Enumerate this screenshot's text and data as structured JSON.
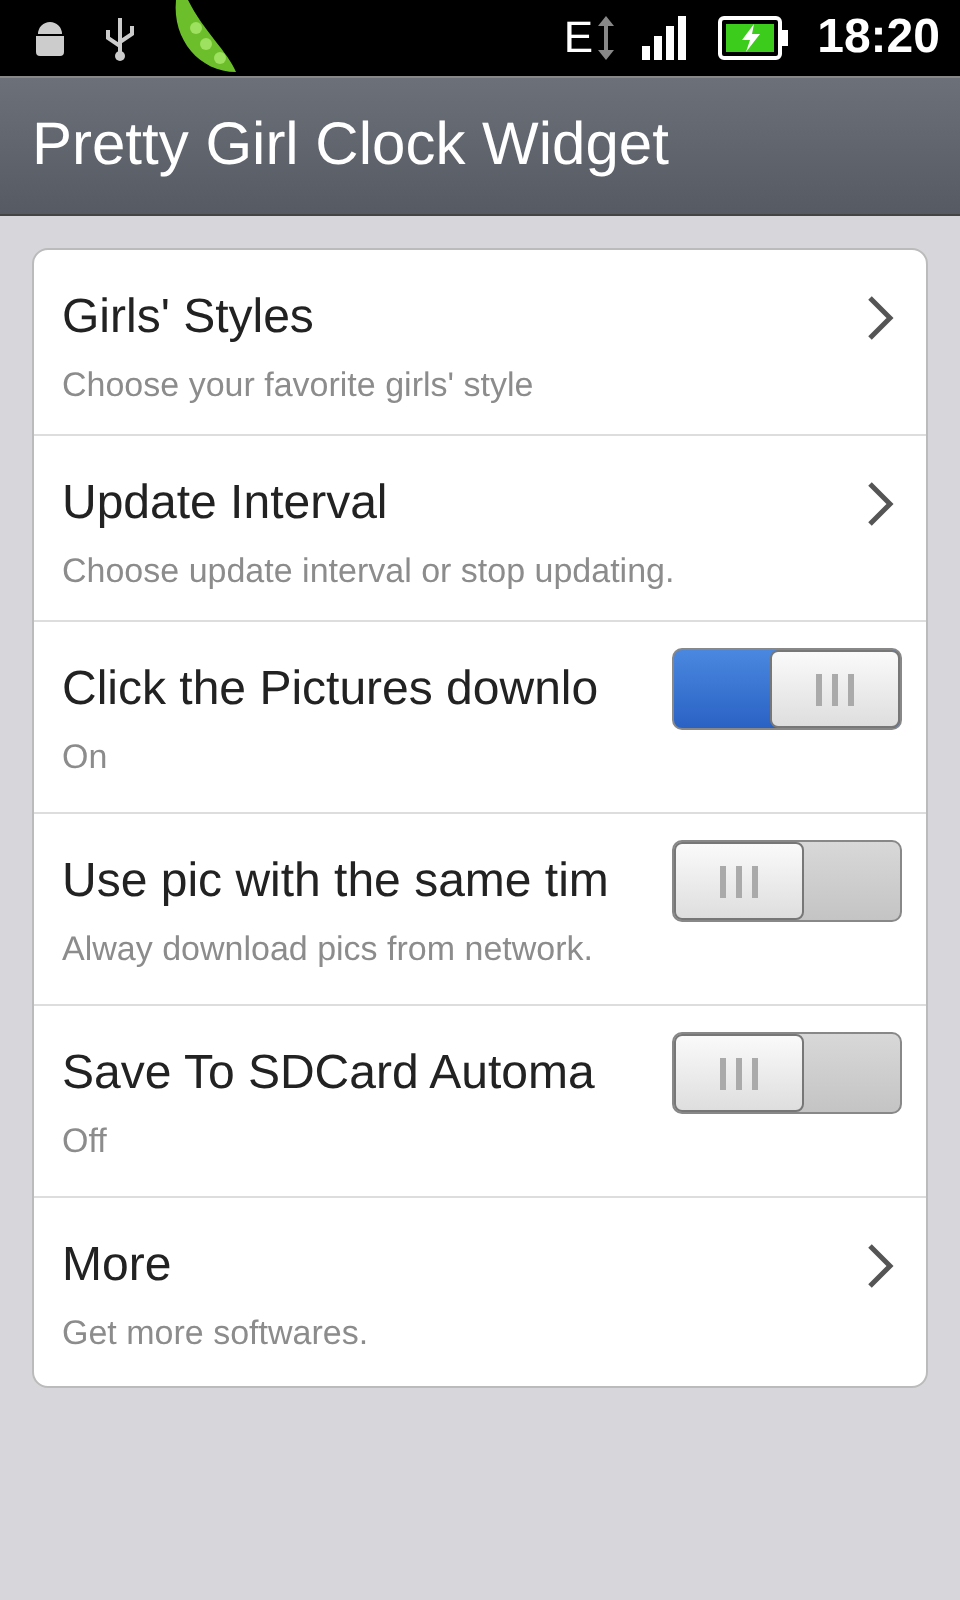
{
  "status_bar": {
    "network": "E",
    "time": "18:20"
  },
  "title": "Pretty Girl Clock Widget",
  "items": [
    {
      "kind": "arrow",
      "title": "Girls' Styles",
      "summary": "Choose your favorite girls' style"
    },
    {
      "kind": "arrow",
      "title": "Update Interval",
      "summary": "Choose update interval or stop updating."
    },
    {
      "kind": "switch",
      "title": "Click the Pictures downlo",
      "summary": "On",
      "on": true
    },
    {
      "kind": "switch",
      "title": "Use pic with the same tim",
      "summary": "Alway download pics from network.",
      "on": false
    },
    {
      "kind": "switch",
      "title": "Save To SDCard Automa",
      "summary": "Off",
      "on": false
    },
    {
      "kind": "arrow",
      "title": "More",
      "summary": "Get more softwares."
    }
  ]
}
